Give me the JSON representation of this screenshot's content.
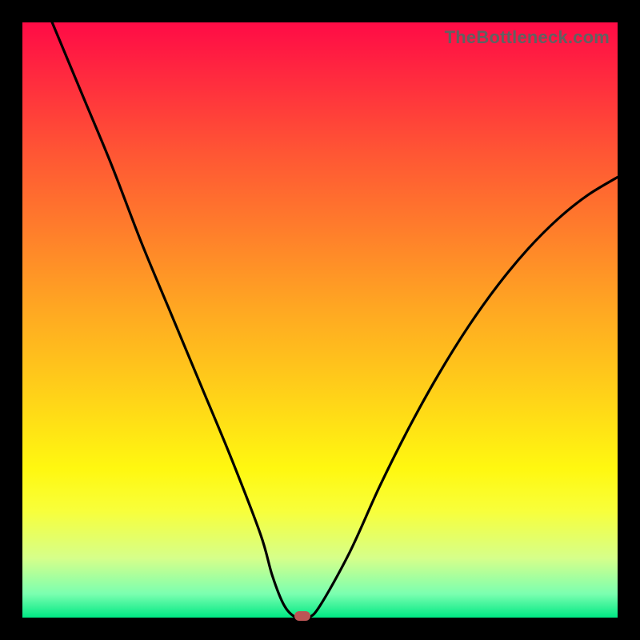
{
  "watermark": "TheBottleneck.com",
  "colors": {
    "frame": "#000000",
    "marker": "#bb5555",
    "curve": "#000000",
    "gradient_stops": [
      "#ff0b46",
      "#ff2d3e",
      "#ff5634",
      "#ff7e2b",
      "#ffa722",
      "#ffd019",
      "#fff810",
      "#f8ff3a",
      "#d6ff8a",
      "#7bffb0",
      "#00e884"
    ]
  },
  "chart_data": {
    "type": "line",
    "title": "",
    "xlabel": "",
    "ylabel": "",
    "xlim": [
      0,
      100
    ],
    "ylim": [
      0,
      100
    ],
    "grid": false,
    "series": [
      {
        "name": "bottleneck-curve",
        "x": [
          5,
          10,
          15,
          20,
          25,
          30,
          35,
          40,
          42,
          44,
          46,
          48,
          50,
          55,
          60,
          65,
          70,
          75,
          80,
          85,
          90,
          95,
          100
        ],
        "y": [
          100,
          88,
          76,
          63,
          51,
          39,
          27,
          14,
          7,
          2,
          0,
          0,
          2,
          11,
          22,
          32,
          41,
          49,
          56,
          62,
          67,
          71,
          74
        ]
      }
    ],
    "marker": {
      "x": 47,
      "y": 0
    },
    "background_meaning": "vertical gradient red (high bottleneck) to green (low bottleneck)"
  }
}
